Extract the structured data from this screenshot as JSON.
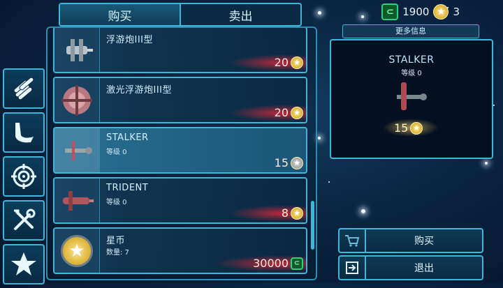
{
  "tabs": {
    "buy": "购买",
    "sell": "卖出"
  },
  "currency": {
    "credits": "1900",
    "stars": "3"
  },
  "categories": [
    {
      "icon": "ammo-rods-icon"
    },
    {
      "icon": "wing-icon"
    },
    {
      "icon": "target-crosshair-icon"
    },
    {
      "icon": "tools-icon"
    },
    {
      "icon": "star-category-icon"
    }
  ],
  "items": [
    {
      "name": "浮游炮III型",
      "level": "",
      "price": "20",
      "currency_icon": "star"
    },
    {
      "name": "激光浮游炮III型",
      "level": "",
      "price": "20",
      "currency_icon": "star"
    },
    {
      "name": "STALKER",
      "level": "等级 0",
      "price": "15",
      "currency_icon": "star"
    },
    {
      "name": "TRIDENT",
      "level": "等级 0",
      "price": "8",
      "currency_icon": "star"
    },
    {
      "name": "星币",
      "level": "数量: 7",
      "price": "30000",
      "currency_icon": "cube"
    }
  ],
  "info": {
    "header": "更多信息",
    "title": "STALKER",
    "level": "等级 0",
    "price": "15"
  },
  "actions": {
    "buy": "购买",
    "exit": "退出"
  },
  "colors": {
    "accent": "#3fb6d8",
    "price_glow": "#dc283c",
    "credit_green": "#2fd07a",
    "star_gold": "#f0c23a"
  }
}
